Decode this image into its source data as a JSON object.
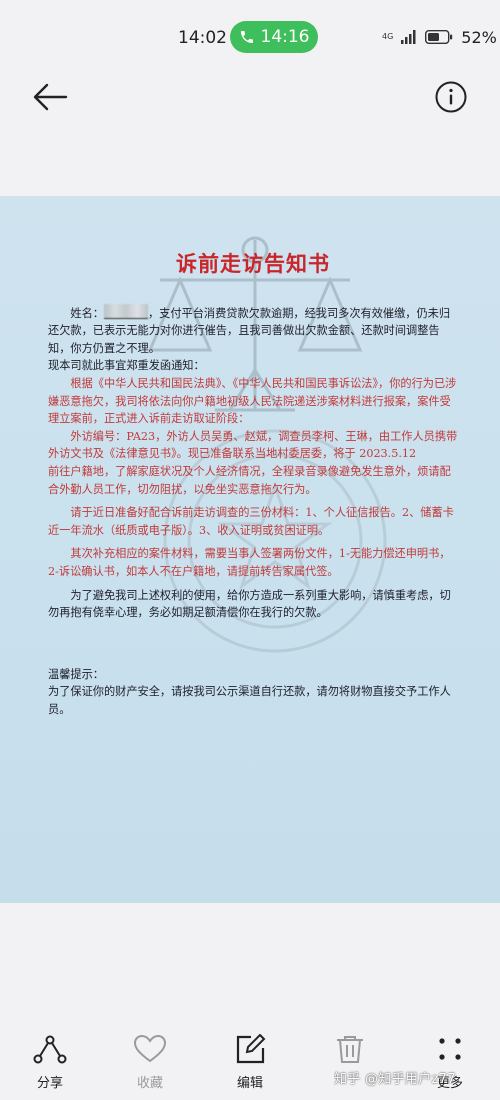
{
  "status_bar": {
    "time": "14:02",
    "call_duration": "14:16",
    "network": "4G",
    "battery": "52%",
    "call_color": "#3fbf5c"
  },
  "header": {
    "back_icon": "arrow-left-icon",
    "info_icon": "info-circle-icon"
  },
  "document": {
    "title": "诉前走访告知书",
    "name_label": "姓名：",
    "name_tail": "，支付平台消费贷款",
    "overdue": "欠款逾期，经我司多次有效催缴，仍未归还欠款，已表示无能力对你进行催告，且我司善做出欠款金额、还款时间调整告知，你方仍置之不理。",
    "notice_intro": "现本司就此事宜郑重发函通知：",
    "legal_basis": "根据《中华人民共和国民法典》、《中华人民共和国民事诉讼法》，你的行为已涉嫌恶意拖欠，我司将依法向你户籍地初级人民法院递送涉案材料进行报案，案件受理立案前，正式进入诉前走访取证阶段：",
    "visit_info": "外访编号：PA23，外访人员吴勇、赵斌，调查员李柯、王琳，由工作人员携带外访文书及《法律意见书》。现已准备联系当地村委居委，将于 2023.5.12　　　前往户籍地，了解家庭状况及个人经济情况，全程录音录像避免发生意外，烦请配合外勤人员工作，切勿阻扰，以免坐实恶意拖欠行为。",
    "materials": "请于近日准备好配合诉前走访调查的三份材料：1、个人征信报告。2、储蓄卡近一年流水（纸质或电子版）。3、收入证明或贫困证明。",
    "supplement": "其次补充相应的案件材料，需要当事人签署两份文件，1-无能力偿还申明书，2-诉讼确认书，如本人不在户籍地，请提前转告家属代签。",
    "warning": "为了避免我司上述权利的使用，给你方造成一系列重大影响，请慎重考虑，切勿再抱有侥幸心理，务必如期足额清偿你在我行的欠款。",
    "tip_label": "温馨提示：",
    "tip_text": "为了保证你的财产安全，请按我司公示渠道自行还款，请勿将财物直接交予工作人员。",
    "text_color": "#1e1e2a",
    "red_color": "#c23a3a",
    "title_color": "#c8262a",
    "background": "#cbe1ee"
  },
  "toolbar": {
    "share": {
      "label": "分享",
      "icon": "share-icon"
    },
    "favorite": {
      "label": "收藏",
      "icon": "heart-icon"
    },
    "edit": {
      "label": "编辑",
      "icon": "edit-icon"
    },
    "delete": {
      "icon": "trash-icon"
    },
    "more": {
      "label": "更多",
      "icon": "more-dots-icon"
    }
  },
  "watermark": "知乎 @知乎用户z77"
}
